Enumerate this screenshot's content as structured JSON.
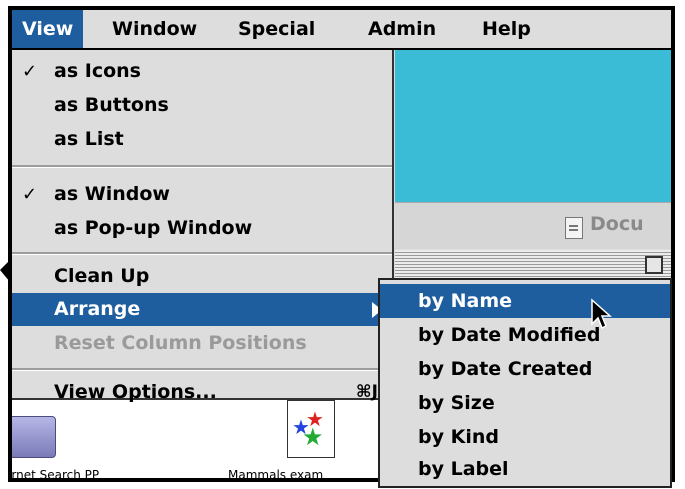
{
  "menubar": {
    "items": [
      {
        "label": "View",
        "active": true
      },
      {
        "label": "Window"
      },
      {
        "label": "Special"
      },
      {
        "label": "Admin"
      },
      {
        "label": "Help"
      }
    ]
  },
  "view_menu": {
    "items": [
      {
        "label": "as Icons",
        "checked": "✓"
      },
      {
        "label": "as Buttons"
      },
      {
        "label": "as List"
      },
      {
        "label": "as Window",
        "checked": "✓"
      },
      {
        "label": "as Pop-up Window"
      },
      {
        "label": "Clean Up"
      },
      {
        "label": "Arrange",
        "selected": true
      },
      {
        "label": "Reset Column Positions",
        "disabled": true
      },
      {
        "label": "View Options...",
        "shortcut": "⌘J"
      }
    ]
  },
  "arrange_submenu": {
    "items": [
      {
        "label": "by Name",
        "selected": true
      },
      {
        "label": "by Date Modified"
      },
      {
        "label": "by Date Created"
      },
      {
        "label": "by Size"
      },
      {
        "label": "by Kind"
      },
      {
        "label": "by Label"
      }
    ]
  },
  "background_window": {
    "toolbar_text": "Docu",
    "icons": [
      {
        "label": "ernet Search PP"
      },
      {
        "label": "Mammals exam"
      }
    ]
  },
  "colors": {
    "highlight": "#1f5e9e",
    "desktop_cyan": "#3bbcd6",
    "menu_bg": "#dddddd"
  }
}
